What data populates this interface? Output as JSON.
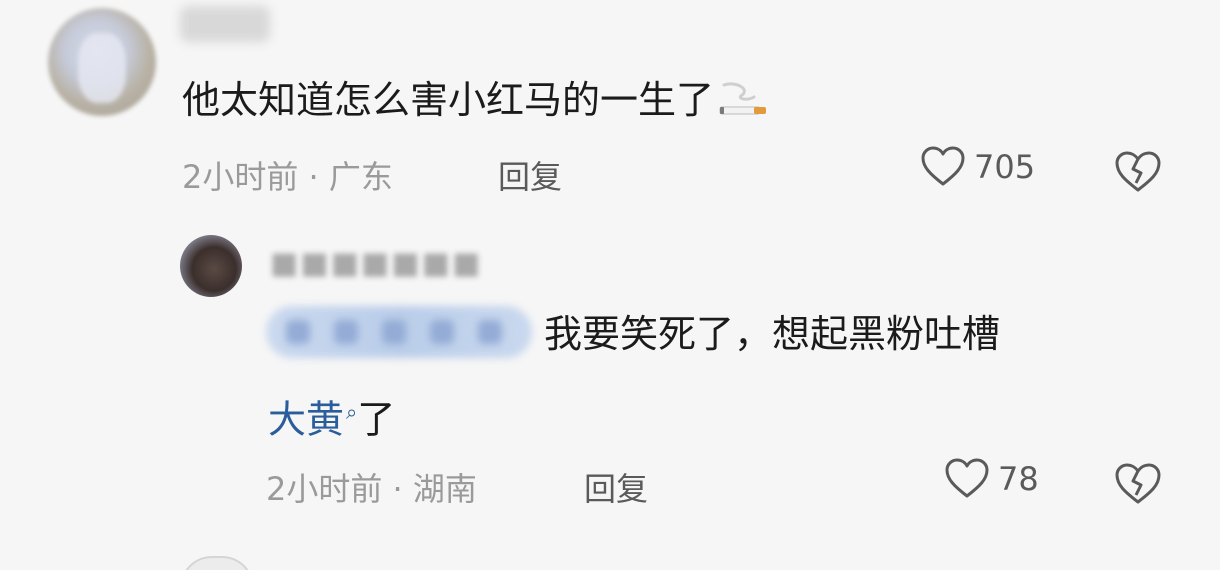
{
  "comments": [
    {
      "text": "他太知道怎么害小红马的一生了",
      "emoji_icon": "cigarette-icon",
      "meta": "2小时前 · 广东",
      "reply_label": "回复",
      "likes": "705"
    },
    {
      "text_after_tag": "我要笑死了，想起黑粉吐槽",
      "link_text": "大黄",
      "text_after_link": "了",
      "meta": "2小时前 · 湖南",
      "reply_label": "回复",
      "likes": "78"
    }
  ],
  "colors": {
    "link": "#2a5d9c",
    "meta": "#9a9a9a",
    "text": "#1b1b1b"
  }
}
